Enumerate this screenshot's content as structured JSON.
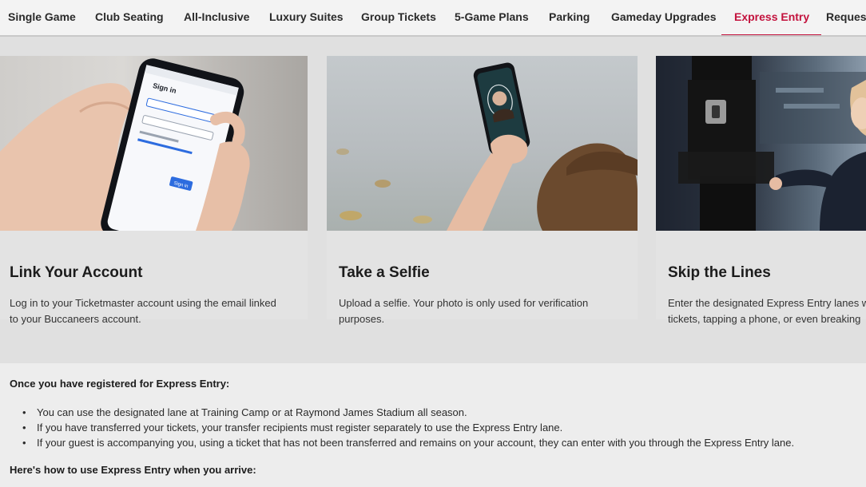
{
  "nav": {
    "tabs": [
      {
        "label": "Single Game"
      },
      {
        "label": "Club Seating"
      },
      {
        "label": "All-Inclusive"
      },
      {
        "label": "Luxury Suites"
      },
      {
        "label": "Group Tickets"
      },
      {
        "label": "5-Game Plans"
      },
      {
        "label": "Parking"
      },
      {
        "label": "Gameday Upgrades"
      },
      {
        "label": "Express Entry"
      },
      {
        "label": "Request"
      }
    ],
    "active_tab": "Express Entry"
  },
  "cards": [
    {
      "title": "Link Your Account",
      "text_lines": [
        "Log in to your Ticketmaster account using the email linked",
        "to your Buccaneers account."
      ],
      "phone_screen": {
        "heading": "Sign in",
        "button": "Sign in"
      }
    },
    {
      "title": "Take a Selfie",
      "text_lines": [
        "Upload a selfie. Your photo is only used for verification",
        "purposes."
      ]
    },
    {
      "title": "Skip the Lines",
      "text_lines": [
        "Enter the designated Express Entry lanes w",
        "tickets, tapping a phone, or even breaking"
      ]
    }
  ],
  "info": {
    "heading": "Once you have registered for Express Entry:",
    "bullets": [
      "You can use the designated lane at Training Camp or at Raymond James Stadium all season.",
      "If you have transferred your tickets, your transfer recipients must register separately to use the Express Entry lane.",
      "If your guest is accompanying you, using a ticket that has not been transferred and remains on your account, they can enter with you through the Express Entry lane."
    ],
    "subheading": "Here's how to use Express Entry when you arrive:"
  },
  "colors": {
    "accent": "#c3123d",
    "nav_bg": "#f3f3f3",
    "page_bg": "#e0e0e0"
  }
}
